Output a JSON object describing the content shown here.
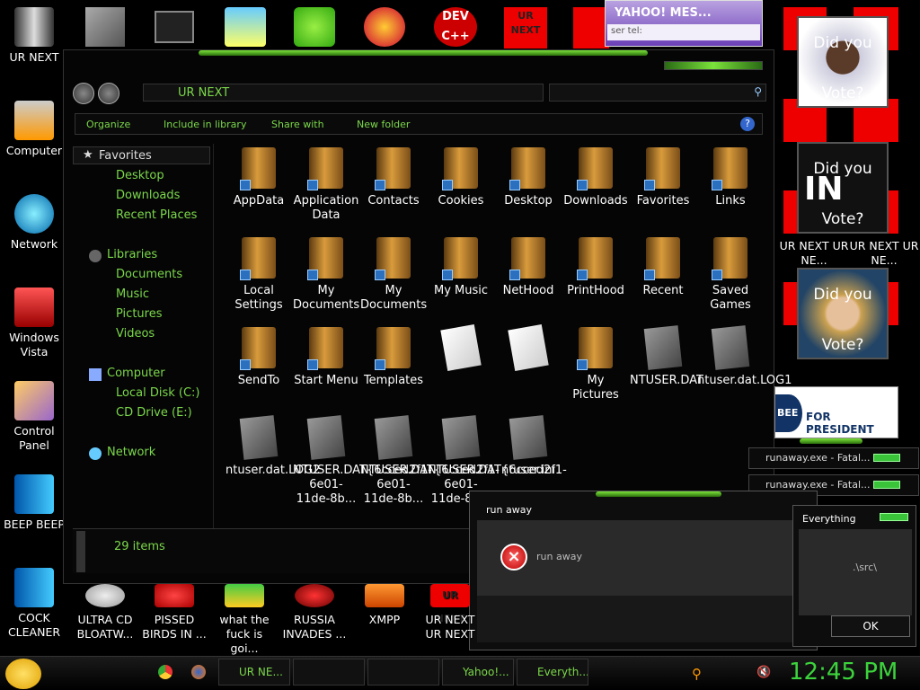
{
  "desktop": {
    "left_icons": [
      "UR NEXT",
      "Computer",
      "Network",
      "Windows Vista",
      "Control Panel",
      "BEEP BEEP",
      "COCK CLEANER"
    ],
    "bottom_icons": [
      "ULTRA CD BLOATW...",
      "PISSED BIRDS IN ...",
      "what the fuck is goi...",
      "RUSSIA INVADES ...",
      "XMPP",
      "UR NEXT UR NEXT"
    ],
    "right_labels": [
      "UR NEXT UR NE...",
      "UR NEXT UR NE..."
    ],
    "ur_next": "UR NEXT",
    "poster_top": "Did you",
    "poster_bottom": "Vote?",
    "poster_in": "IN",
    "bee": "BEE",
    "for_president": "FOR PRESIDENT",
    "dev_text": "DEV C++"
  },
  "yahoo": {
    "title": "YAHOO! MES...",
    "status": "ser tel:"
  },
  "explorer": {
    "address": "UR NEXT",
    "commands": [
      "Organize",
      "Include in library",
      "Share with",
      "New folder"
    ],
    "sidebar": {
      "favorites": "Favorites",
      "fav_items": [
        "Desktop",
        "Downloads",
        "Recent Places"
      ],
      "libraries": "Libraries",
      "lib_items": [
        "Documents",
        "Music",
        "Pictures",
        "Videos"
      ],
      "computer": "Computer",
      "comp_items": [
        "Local Disk (C:)",
        "CD Drive (E:)"
      ],
      "network": "Network"
    },
    "files": [
      "AppData",
      "Application Data",
      "Contacts",
      "Cookies",
      "Desktop",
      "Downloads",
      "Favorites",
      "Links",
      "Local Settings",
      "My Documents",
      "My Documents",
      "My Music",
      "NetHood",
      "PrintHood",
      "Recent",
      "Saved Games",
      "SendTo",
      "Start Menu",
      "Templates",
      "",
      "",
      "My Pictures",
      "NTUSER.DAT",
      "ntuser.dat.LOG1",
      "ntuser.dat.LOG2",
      "NTUSER.DAT{6cced2f1-6e01-11de-8b...",
      "NTUSER.DAT{6cced2f1-6e01-11de-8b...",
      "NTUSER.DAT{6cced2f1-6e01-11de-8b...",
      "ntuser.ini"
    ],
    "status": "29 items"
  },
  "notifications": [
    "runaway.exe - Fatal...",
    "runaway.exe - Fatal..."
  ],
  "dialog": {
    "title": "run away",
    "message": "run away"
  },
  "everything": {
    "title": "Everything",
    "path": ".\\src\\",
    "ok": "OK"
  },
  "taskbar": {
    "tasks": [
      "UR NE...",
      "",
      "",
      "Yahoo!...",
      "Everyth..."
    ],
    "clock": "12:45 PM"
  },
  "colors": {
    "accent": "#7bd84a",
    "ur_red": "#ee0000"
  }
}
